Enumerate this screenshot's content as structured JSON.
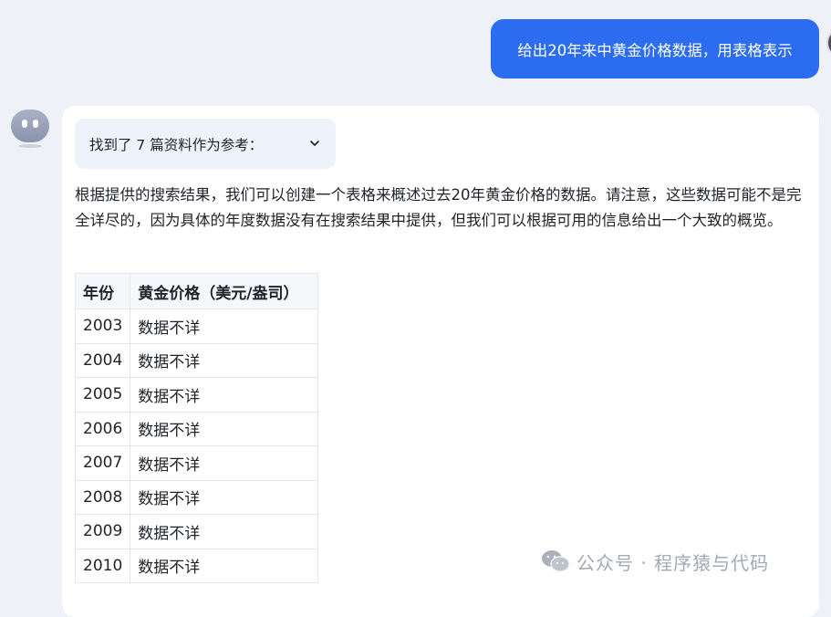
{
  "user_message": {
    "text": "给出20年来中黄金价格数据，用表格表示"
  },
  "bot": {
    "references_label": "找到了 7 篇资料作为参考：",
    "answer_paragraph": "根据提供的搜索结果，我们可以创建一个表格来概述过去20年黄金价格的数据。请注意，这些数据可能不是完全详尽的，因为具体的年度数据没有在搜索结果中提供，但我们可以根据可用的信息给出一个大致的概览。",
    "table": {
      "headers": [
        "年份",
        "黄金价格（美元/盎司）"
      ],
      "rows": [
        [
          "2003",
          "数据不详"
        ],
        [
          "2004",
          "数据不详"
        ],
        [
          "2005",
          "数据不详"
        ],
        [
          "2006",
          "数据不详"
        ],
        [
          "2007",
          "数据不详"
        ],
        [
          "2008",
          "数据不详"
        ],
        [
          "2009",
          "数据不详"
        ],
        [
          "2010",
          "数据不详"
        ]
      ]
    }
  },
  "watermark": {
    "text": "公众号 · 程序猿与代码",
    "icon": "wechat-icon"
  },
  "colors": {
    "user_bubble": "#2b6cf0",
    "page_bg": "#eef1f7",
    "card_bg": "#ffffff",
    "refs_bg": "#eef2fb"
  }
}
